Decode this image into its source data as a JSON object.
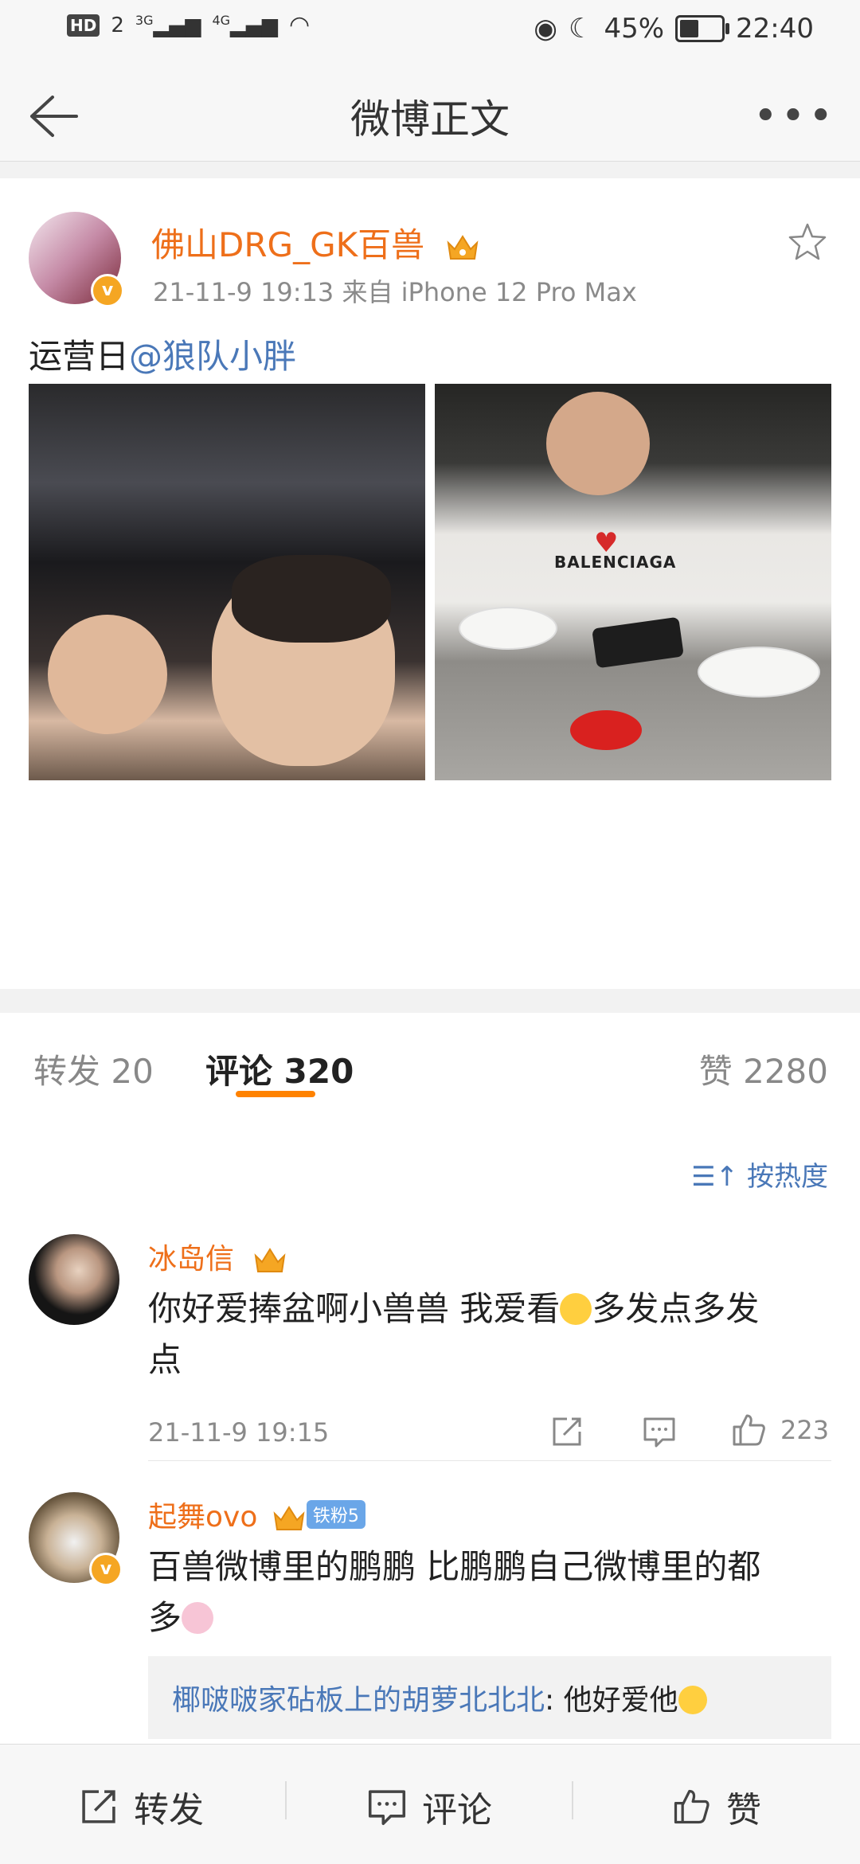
{
  "status_bar": {
    "left_items": [
      "HD",
      "2",
      "3G",
      "4G"
    ],
    "battery": "45%",
    "battery_level": 0.45,
    "time": "22:40"
  },
  "nav": {
    "title": "微博正文"
  },
  "post": {
    "author": "佛山DRG_GK百兽",
    "meta": "21-11-9 19:13  来自 iPhone 12 Pro Max",
    "text_prefix": "运营日",
    "mention": "@狼队小胖",
    "photo2_caption": "BALENCIAGA"
  },
  "share_icons": [
    "wechat-icon",
    "moments-icon",
    "qq-icon",
    "save-image-icon"
  ],
  "tabs": {
    "repost": "转发 20",
    "comment": "评论 320",
    "like": "赞 2280"
  },
  "sort_label": "按热度",
  "comments": [
    {
      "name": "冰岛信",
      "text_line1": "你好爱捧盆啊小兽兽 我爱看",
      "text_line1_end": "多发点多发",
      "text_line2": "点",
      "time": "21-11-9 19:15",
      "likes": "223"
    },
    {
      "name": "起舞ovo",
      "fan_badge": "铁粉5",
      "text_line1": "百兽微博里的鹏鹏 比鹏鹏自己微博里的都",
      "text_line2": "多",
      "reply_name": "椰啵啵家砧板上的胡萝北北北",
      "reply_text": ": 他好爱他"
    }
  ],
  "bottom_bar": {
    "repost": "转发",
    "comment": "评论",
    "like": "赞"
  },
  "colors": {
    "accent_orange": "#ee6f1a",
    "link_blue": "#4a78b8",
    "tab_underline": "#ff8200"
  }
}
